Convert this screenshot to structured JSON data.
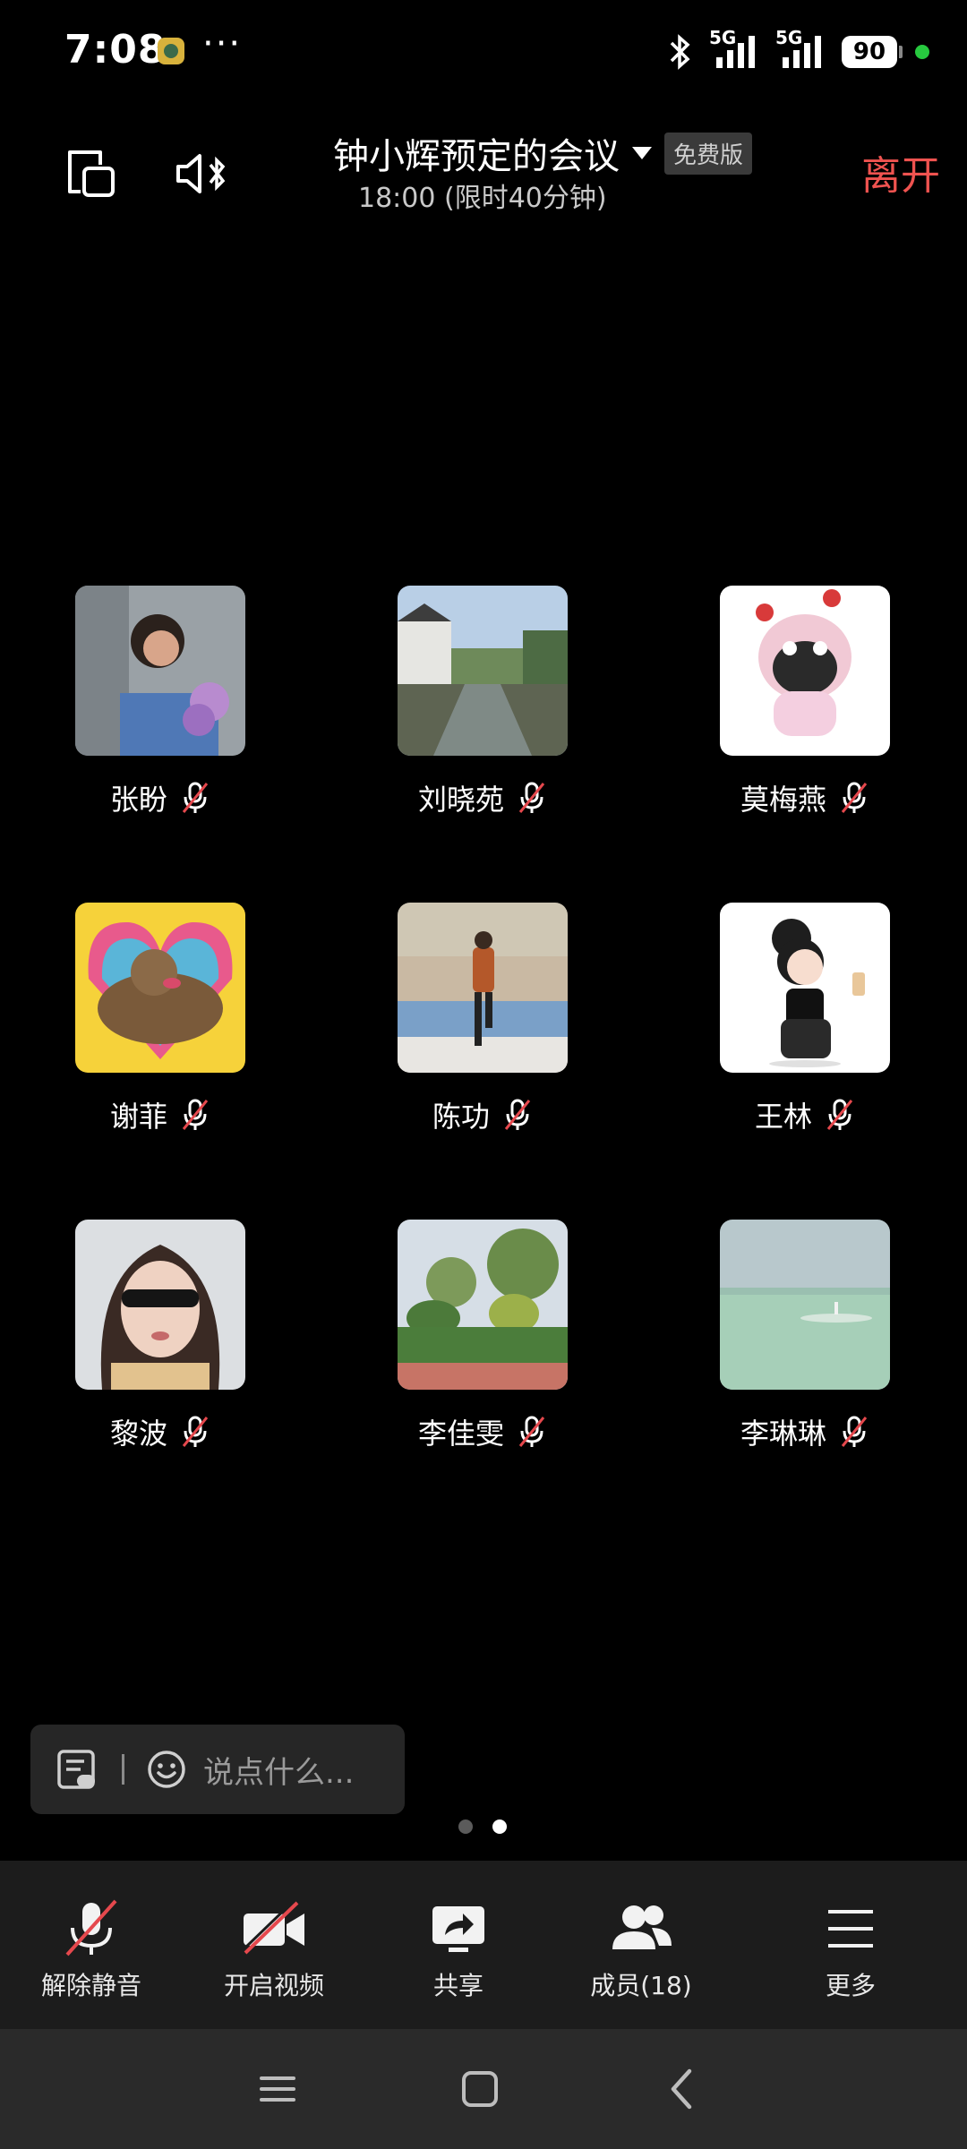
{
  "status_bar": {
    "time": "7:08",
    "more": "···",
    "signal1_label": "5G",
    "signal2_label": "5G",
    "battery": "90"
  },
  "meeting": {
    "title": "钟小辉预定的会议",
    "badge": "免费版",
    "subtitle": "18:00 (限时40分钟)",
    "leave_label": "离开"
  },
  "participants": [
    {
      "name": "张盼",
      "avatar": "woman-jacket-photo",
      "muted": true
    },
    {
      "name": "刘晓苑",
      "avatar": "canal-town-photo",
      "muted": true
    },
    {
      "name": "莫梅燕",
      "avatar": "cartoon-pink-character",
      "muted": true
    },
    {
      "name": "谢菲",
      "avatar": "cat-heart-sticker",
      "muted": true
    },
    {
      "name": "陈功",
      "avatar": "man-brick-wall-photo",
      "muted": true
    },
    {
      "name": "王林",
      "avatar": "cartoon-girl-coffee",
      "muted": true
    },
    {
      "name": "黎波",
      "avatar": "woman-sunglasses-photo",
      "muted": true
    },
    {
      "name": "李佳雯",
      "avatar": "garden-shrubs-photo",
      "muted": true
    },
    {
      "name": "李琳琳",
      "avatar": "lake-shore-photo",
      "muted": true
    }
  ],
  "chat": {
    "placeholder": "说点什么..."
  },
  "pager": {
    "total": 2,
    "current": 2
  },
  "toolbar": {
    "unmute_label": "解除静音",
    "video_label": "开启视频",
    "share_label": "共享",
    "members_label": "成员(18)",
    "more_label": "更多"
  },
  "colors": {
    "leave": "#ef5350",
    "background": "#000000",
    "toolbar": "#1c1c1c",
    "mute_slash": "#e5484d"
  }
}
